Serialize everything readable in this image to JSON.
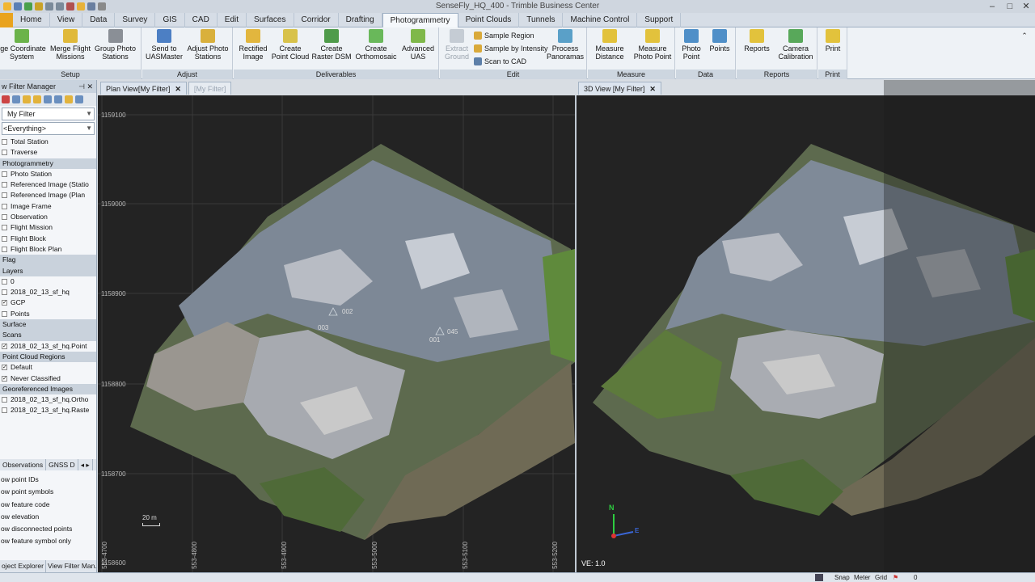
{
  "window": {
    "title": "SenseFly_HQ_400 - Trimble Business Center"
  },
  "ribbon_tabs": [
    {
      "label": "Home"
    },
    {
      "label": "View"
    },
    {
      "label": "Data"
    },
    {
      "label": "Survey"
    },
    {
      "label": "GIS"
    },
    {
      "label": "CAD"
    },
    {
      "label": "Edit"
    },
    {
      "label": "Surfaces"
    },
    {
      "label": "Corridor"
    },
    {
      "label": "Drafting"
    },
    {
      "label": "Photogrammetry"
    },
    {
      "label": "Point Clouds"
    },
    {
      "label": "Tunnels"
    },
    {
      "label": "Machine Control"
    },
    {
      "label": "Support"
    }
  ],
  "ribbon": {
    "setup": {
      "label": "Setup",
      "buttons": [
        "rge Coordinate System",
        "Merge Flight Missions",
        "Group Photo Stations"
      ]
    },
    "adjust": {
      "label": "Adjust",
      "buttons": [
        "Send to UASMaster",
        "Adjust Photo Stations"
      ]
    },
    "deliverables": {
      "label": "Deliverables",
      "buttons": [
        "Rectified Image",
        "Create Point Cloud",
        "Create Raster DSM",
        "Create Orthomosaic",
        "Advanced UAS"
      ]
    },
    "edit": {
      "label": "Edit",
      "extract": "Extract Ground",
      "sample_region": "Sample Region",
      "sample_intensity": "Sample by Intensity",
      "scan_to_cad": "Scan to CAD",
      "process_panoramas": "Process Panoramas"
    },
    "measure": {
      "label": "Measure",
      "buttons": [
        "Measure Distance",
        "Measure Photo Point"
      ]
    },
    "data": {
      "label": "Data",
      "buttons": [
        "Photo Point",
        "Points"
      ]
    },
    "reports": {
      "label": "Reports",
      "buttons": [
        "Reports",
        "Camera Calibration"
      ]
    },
    "print": {
      "label": "Print",
      "buttons": [
        "Print"
      ]
    }
  },
  "filter_panel": {
    "title": "w Filter Manager",
    "filter_name": "My Filter",
    "everything": "<Everything>",
    "rows": [
      {
        "type": "item",
        "label": "Total Station",
        "check": ""
      },
      {
        "type": "item",
        "label": "Traverse",
        "check": ""
      },
      {
        "type": "cat",
        "label": "Photogrammetry"
      },
      {
        "type": "item",
        "label": "Photo Station",
        "check": ""
      },
      {
        "type": "item",
        "label": "Referenced Image (Statio",
        "check": ""
      },
      {
        "type": "item",
        "label": "Referenced Image (Plan",
        "check": ""
      },
      {
        "type": "item",
        "label": "Image Frame",
        "check": ""
      },
      {
        "type": "item",
        "label": "Observation",
        "check": ""
      },
      {
        "type": "item",
        "label": "Flight Mission",
        "check": ""
      },
      {
        "type": "item",
        "label": "Flight Block",
        "check": ""
      },
      {
        "type": "item",
        "label": "Flight Block Plan",
        "check": ""
      },
      {
        "type": "cat",
        "label": "Flag"
      },
      {
        "type": "cat",
        "label": "Layers"
      },
      {
        "type": "item",
        "label": "0",
        "check": ""
      },
      {
        "type": "item",
        "label": "2018_02_13_sf_hq",
        "check": ""
      },
      {
        "type": "item",
        "label": "GCP",
        "check": "✓"
      },
      {
        "type": "item",
        "label": "Points",
        "check": ""
      },
      {
        "type": "cat",
        "label": "Surface"
      },
      {
        "type": "cat",
        "label": "Scans"
      },
      {
        "type": "item",
        "label": "2018_02_13_sf_hq.Point",
        "check": "✓"
      },
      {
        "type": "cat",
        "label": "Point Cloud Regions"
      },
      {
        "type": "item",
        "label": "Default",
        "check": "✓"
      },
      {
        "type": "item",
        "label": "Never Classified",
        "check": "✓"
      },
      {
        "type": "cat",
        "label": "Georeferenced Images"
      },
      {
        "type": "item",
        "label": "2018_02_13_sf_hq.Ortho",
        "check": ""
      },
      {
        "type": "item",
        "label": "2018_02_13_sf_hq.Raste",
        "check": ""
      }
    ],
    "sub_tabs": [
      "Observations",
      "GNSS D"
    ],
    "options": [
      "ow point IDs",
      "ow point symbols",
      "ow feature code",
      "ow elevation",
      "ow disconnected points",
      "ow feature symbol only"
    ],
    "bottom_tabs": [
      "oject Explorer",
      "View Filter Man..."
    ]
  },
  "plan_view": {
    "tab": "Plan View[My Filter]",
    "tab2": "[My Filter]",
    "y_labels": [
      "1159100",
      "1159000",
      "1158900",
      "1158800",
      "1158700",
      "1158600"
    ],
    "x_labels": [
      "553-4700",
      "553-4800",
      "553-4900",
      "553-5000",
      "553-5100",
      "553-5200"
    ],
    "points": [
      "002",
      "003",
      "045",
      "001"
    ],
    "scale": "20 m"
  },
  "view_3d": {
    "tab": "3D View [My Filter]",
    "ve": "VE: 1.0",
    "north": "N",
    "east": "E"
  },
  "status_bar": {
    "snap": "Snap",
    "units": "Meter",
    "grid": "Grid",
    "count": "0"
  },
  "colors": {
    "accent": "#e9a31e",
    "ribbon_bg": "#eef2f6",
    "view_bg": "#232323"
  }
}
